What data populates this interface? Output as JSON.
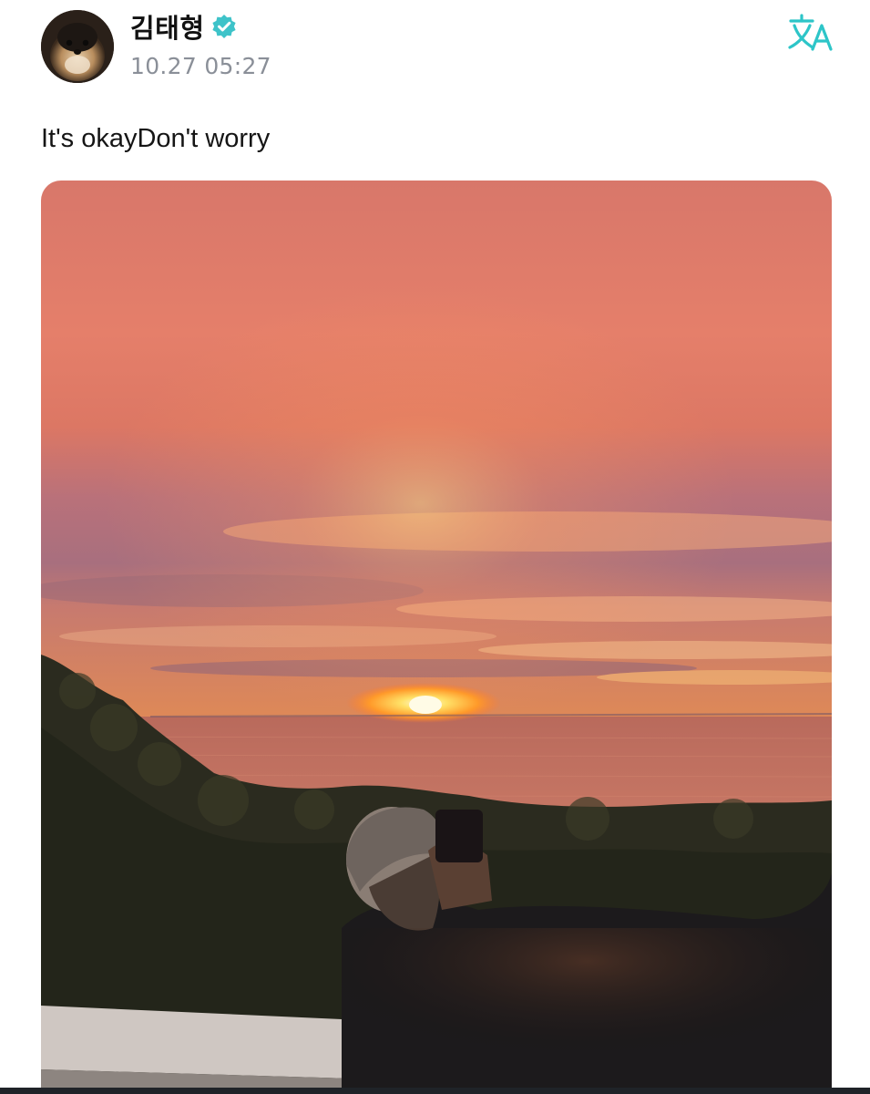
{
  "post": {
    "author": {
      "name": "김태형",
      "verified": true,
      "avatar_icon": "dog-avatar-icon"
    },
    "timestamp": "10.27 05:27",
    "text": "It's okayDon't worry",
    "actions": {
      "translate_icon": "translate-icon"
    },
    "photo": {
      "type": "image",
      "subject": "sunset over sea"
    }
  },
  "colors": {
    "verified_badge": "#3ec3c9",
    "translate_icon": "#2dc5c8",
    "timestamp": "#8a8f98",
    "text": "#151515"
  }
}
